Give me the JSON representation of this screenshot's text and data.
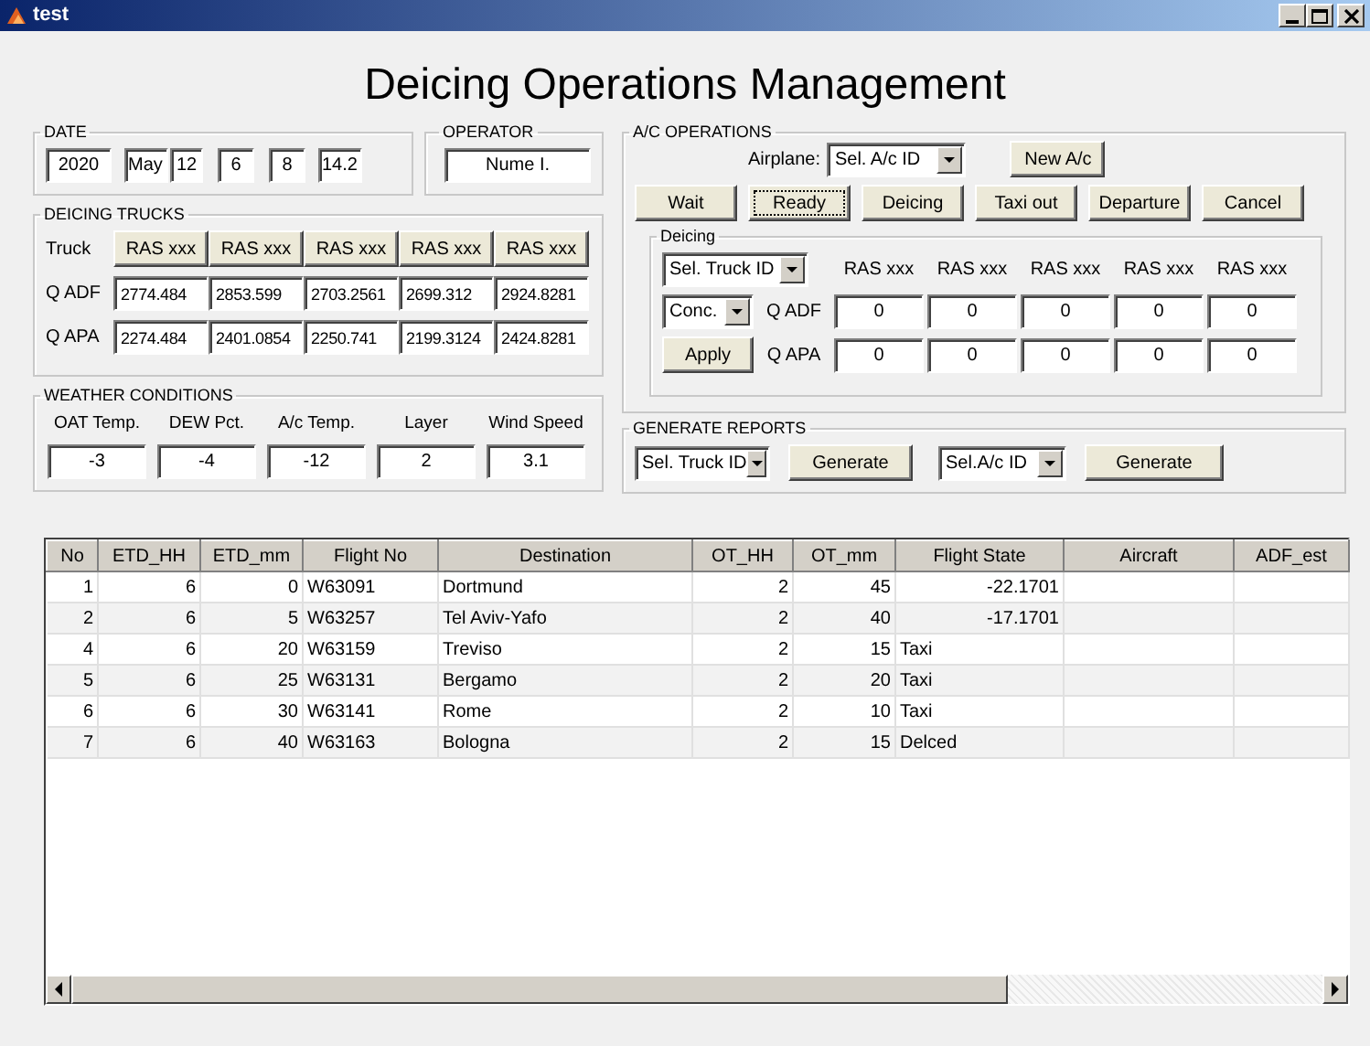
{
  "window": {
    "title": "test"
  },
  "heading": "Deicing Operations Management",
  "date": {
    "label": "DATE",
    "fields": [
      "2020",
      "May",
      "12",
      "6",
      "8",
      "14.2"
    ]
  },
  "operator": {
    "label": "OPERATOR",
    "value": "Nume I."
  },
  "deicing_trucks": {
    "label": "DEICING TRUCKS",
    "rows": [
      {
        "label": "Truck",
        "kind": "buttons",
        "values": [
          "RAS xxx",
          "RAS xxx",
          "RAS xxx",
          "RAS xxx",
          "RAS xxx"
        ]
      },
      {
        "label": "Q ADF",
        "kind": "fields",
        "values": [
          "2774.484",
          "2853.599",
          "2703.2561",
          "2699.312",
          "2924.8281"
        ]
      },
      {
        "label": "Q APA",
        "kind": "fields",
        "values": [
          "2274.484",
          "2401.0854",
          "2250.741",
          "2199.3124",
          "2424.8281"
        ]
      }
    ]
  },
  "weather": {
    "label": "WEATHER CONDITIONS",
    "items": [
      {
        "label": "OAT Temp.",
        "value": "-3"
      },
      {
        "label": "DEW Pct.",
        "value": "-4"
      },
      {
        "label": "A/c Temp.",
        "value": "-12"
      },
      {
        "label": "Layer",
        "value": "2"
      },
      {
        "label": "Wind Speed",
        "value": "3.1"
      }
    ]
  },
  "ac_operations": {
    "label": "A/C OPERATIONS",
    "airplane_label": "Airplane:",
    "airplane_select": "Sel. A/c ID",
    "new_button": "New A/c",
    "state_buttons": [
      {
        "label": "Wait",
        "focused": false
      },
      {
        "label": "Ready",
        "focused": true
      },
      {
        "label": "Deicing",
        "focused": false
      },
      {
        "label": "Taxi out",
        "focused": false
      },
      {
        "label": "Departure",
        "focused": false
      },
      {
        "label": "Cancel",
        "focused": false
      }
    ],
    "deicing": {
      "label": "Deicing",
      "truck_select": "Sel. Truck ID",
      "conc_select": "Conc.",
      "apply_button": "Apply",
      "truck_headers": [
        "RAS xxx",
        "RAS xxx",
        "RAS xxx",
        "RAS xxx",
        "RAS xxx"
      ],
      "rows": [
        {
          "label": "Q ADF",
          "values": [
            "0",
            "0",
            "0",
            "0",
            "0"
          ]
        },
        {
          "label": "Q APA",
          "values": [
            "0",
            "0",
            "0",
            "0",
            "0"
          ]
        }
      ]
    }
  },
  "generate_reports": {
    "label": "GENERATE REPORTS",
    "items": [
      {
        "select": "Sel. Truck ID",
        "button": "Generate"
      },
      {
        "select": "Sel.A/c ID",
        "button": "Generate"
      }
    ]
  },
  "table": {
    "columns": [
      "No",
      "ETD_HH",
      "ETD_mm",
      "Flight No",
      "Destination",
      "OT_HH",
      "OT_mm",
      "Flight State",
      "Aircraft",
      "ADF_est"
    ],
    "rows": [
      [
        "1",
        "6",
        "0",
        "W63091",
        "Dortmund",
        "2",
        "45",
        "-22.1701"
      ],
      [
        "2",
        "6",
        "5",
        "W63257",
        "Tel Aviv-Yafo",
        "2",
        "40",
        "-17.1701"
      ],
      [
        "4",
        "6",
        "20",
        "W63159",
        "Treviso",
        "2",
        "15",
        "Taxi"
      ],
      [
        "5",
        "6",
        "25",
        "W63131",
        "Bergamo",
        "2",
        "20",
        "Taxi"
      ],
      [
        "6",
        "6",
        "30",
        "W63141",
        "Rome",
        "2",
        "10",
        "Taxi"
      ],
      [
        "7",
        "6",
        "40",
        "W63163",
        "Bologna",
        "2",
        "15",
        "Delced"
      ]
    ]
  }
}
